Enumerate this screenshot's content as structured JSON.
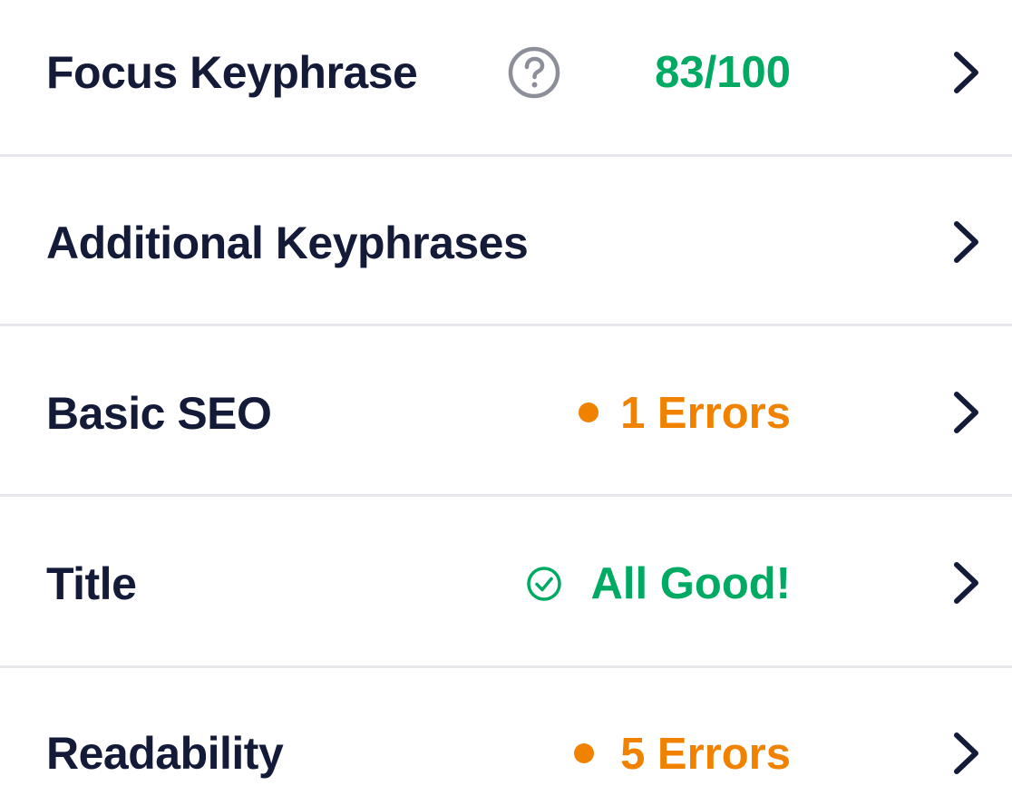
{
  "rows": [
    {
      "label": "Focus Keyphrase",
      "status": "83/100",
      "status_color": "#00aa63",
      "icon": "question-circle-icon"
    },
    {
      "label": "Additional Keyphrases"
    },
    {
      "label": "Basic SEO",
      "status": "1 Errors",
      "status_color": "#f18200",
      "icon": "dot-icon"
    },
    {
      "label": "Title",
      "status": "All Good!",
      "status_color": "#00aa63",
      "icon": "check-circle-icon"
    },
    {
      "label": "Readability",
      "status": "5 Errors",
      "status_color": "#f18200",
      "icon": "dot-icon"
    }
  ],
  "colors": {
    "text": "#141b38",
    "good": "#00aa63",
    "warning": "#f18200",
    "divider": "#e7e8ec",
    "help_icon": "#8c8f9a"
  },
  "chevron": "chevron-right-icon"
}
